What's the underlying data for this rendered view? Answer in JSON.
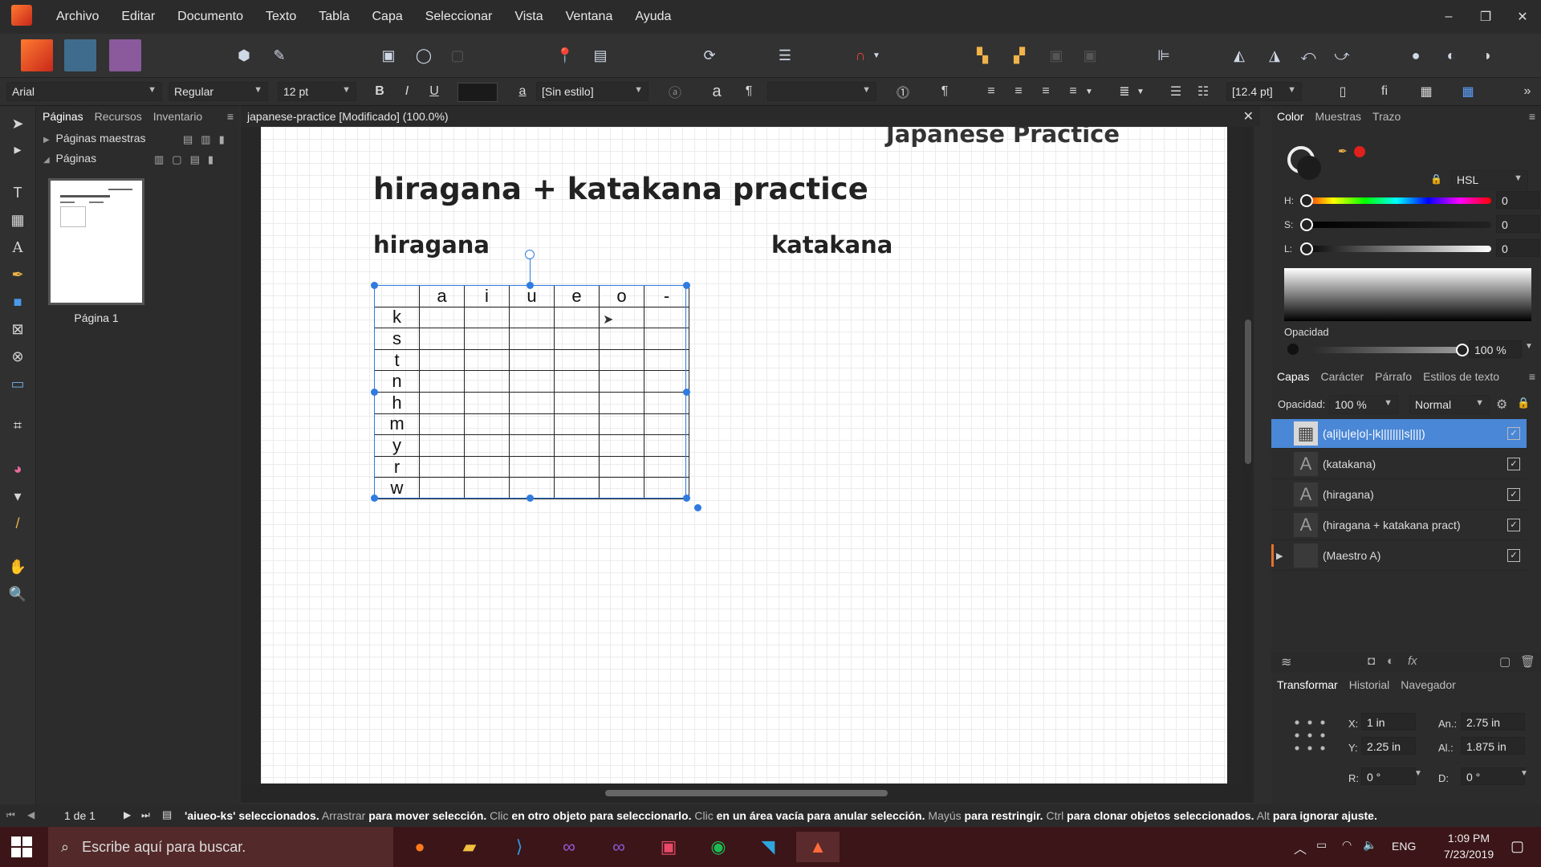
{
  "menu": {
    "items": [
      "Archivo",
      "Editar",
      "Documento",
      "Texto",
      "Tabla",
      "Capa",
      "Seleccionar",
      "Vista",
      "Ventana",
      "Ayuda"
    ]
  },
  "window_controls": {
    "minimize": "–",
    "restore": "❐",
    "close": "✕"
  },
  "context": {
    "font_family": "Arial",
    "font_style": "Regular",
    "font_size": "12 pt",
    "bold": "B",
    "italic": "I",
    "underline": "U",
    "text_style": "[Sin estilo]",
    "glyph_a": "a",
    "pilcrow": "¶",
    "leading": "[12.4 pt]",
    "fi": "fi"
  },
  "pages_panel": {
    "tabs": [
      "Páginas",
      "Recursos",
      "Inventario"
    ],
    "master_pages": "Páginas maestras",
    "pages": "Páginas",
    "page1": "Página 1"
  },
  "document": {
    "tab_title": "japanese-practice [Modificado] (100.0%)",
    "header_text": "Japanese Practice",
    "title": "hiragana + katakana practice",
    "hiragana_label": "hiragana",
    "katakana_label": "katakana",
    "table": {
      "columns": [
        "",
        "a",
        "i",
        "u",
        "e",
        "o",
        "-"
      ],
      "rows": [
        "k",
        "s",
        "t",
        "n",
        "h",
        "m",
        "y",
        "r",
        "w"
      ]
    }
  },
  "color_panel": {
    "tabs": [
      "Color",
      "Muestras",
      "Trazo"
    ],
    "model": "HSL",
    "h_label": "H:",
    "h_value": "0",
    "s_label": "S:",
    "s_value": "0",
    "l_label": "L:",
    "l_value": "0",
    "opacity_label": "Opacidad",
    "opacity_value": "100 %",
    "opacity_fraction": 1.0
  },
  "layers_panel": {
    "tabs": [
      "Capas",
      "Carácter",
      "Párrafo",
      "Estilos de texto"
    ],
    "opacity_label": "Opacidad:",
    "opacity_value": "100 %",
    "blend_mode": "Normal",
    "layers": [
      {
        "name": "(a|i|u|e|o|-|k||||||||s||||)",
        "icon": "table-icon",
        "selected": true
      },
      {
        "name": "(katakana)",
        "icon": "text-frame-icon",
        "selected": false
      },
      {
        "name": "(hiragana)",
        "icon": "text-frame-icon",
        "selected": false
      },
      {
        "name": "(hiragana + katakana pract)",
        "icon": "text-frame-icon",
        "selected": false
      },
      {
        "name": "(Maestro A)",
        "icon": "master-icon",
        "selected": false
      }
    ]
  },
  "transform_panel": {
    "tabs": [
      "Transformar",
      "Historial",
      "Navegador"
    ],
    "x_label": "X:",
    "x_value": "1 in",
    "y_label": "Y:",
    "y_value": "2.25 in",
    "w_label": "An.:",
    "w_value": "2.75 in",
    "h_label": "Al.:",
    "h_value": "1.875 in",
    "r_label": "R:",
    "r_value": "0 °",
    "d_label": "D:",
    "d_value": "0 °"
  },
  "status": {
    "page_count": "1 de 1",
    "selection": "'aiueo-ks' seleccionados.",
    "hint1": "Arrastrar",
    "hint1b": "para mover selección.",
    "hint2": "Clic",
    "hint2b": "en otro objeto para seleccionarlo.",
    "hint3": "Clic",
    "hint3b": "en un área vacía para anular selección.",
    "hint4": "Mayús",
    "hint4b": "para restringir.",
    "hint5": "Ctrl",
    "hint5b": "para clonar objetos seleccionados.",
    "hint6": "Alt",
    "hint6b": "para ignorar ajuste."
  },
  "taskbar": {
    "search_placeholder": "Escribe aquí para buscar.",
    "lang": "ENG",
    "time": "1:09 PM",
    "date": "7/23/2019"
  },
  "colors": {
    "accent": "#2f7be0",
    "taskbar": "#3b1517",
    "selected_layer": "#4a87d6"
  }
}
